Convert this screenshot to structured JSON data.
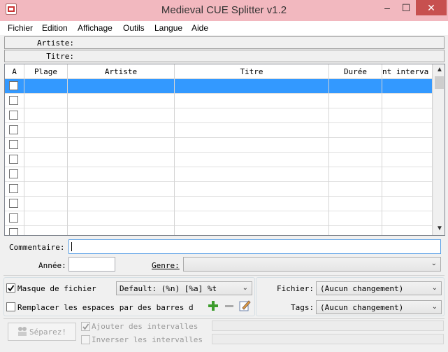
{
  "window": {
    "title": "Medieval CUE Splitter v1.2",
    "minimize_glyph": "‒",
    "maximize_glyph": "☐",
    "close_glyph": "✕",
    "title_color": "#f2b8bf"
  },
  "menu": [
    "Fichier",
    "Edition",
    "Affichage",
    "Outils",
    "Langue",
    "Aide"
  ],
  "info": {
    "artist_label": "Artiste:",
    "title_label": "Titre:"
  },
  "table": {
    "headers": [
      "A",
      "Plage",
      "Artiste",
      "Titre",
      "Durée",
      "nt interva"
    ],
    "row_count": 11,
    "selected_row_color": "#3399ff"
  },
  "comment": {
    "label": "Commentaire:"
  },
  "year": {
    "label": "Année:"
  },
  "genre": {
    "label": "Genre:"
  },
  "file_mask": {
    "label": "Masque de fichier",
    "checked": true,
    "value": "Default: (%n) [%a] %t"
  },
  "replace_spaces": {
    "label": "Remplacer les espaces par des barres d",
    "checked": false
  },
  "output": {
    "file_label": "Fichier:",
    "file_value": "(Aucun changement)",
    "tags_label": "Tags:",
    "tags_value": "(Aucun changement)"
  },
  "split_button": {
    "label": "Séparez!"
  },
  "add_intervals": {
    "label": "Ajouter des intervalles",
    "checked": true
  },
  "invert_intervals": {
    "label": "Inverser les intervalles",
    "checked": false
  },
  "icons": {
    "add": "plus-icon",
    "remove": "minus-icon",
    "edit": "edit-icon",
    "split": "split-icon"
  }
}
